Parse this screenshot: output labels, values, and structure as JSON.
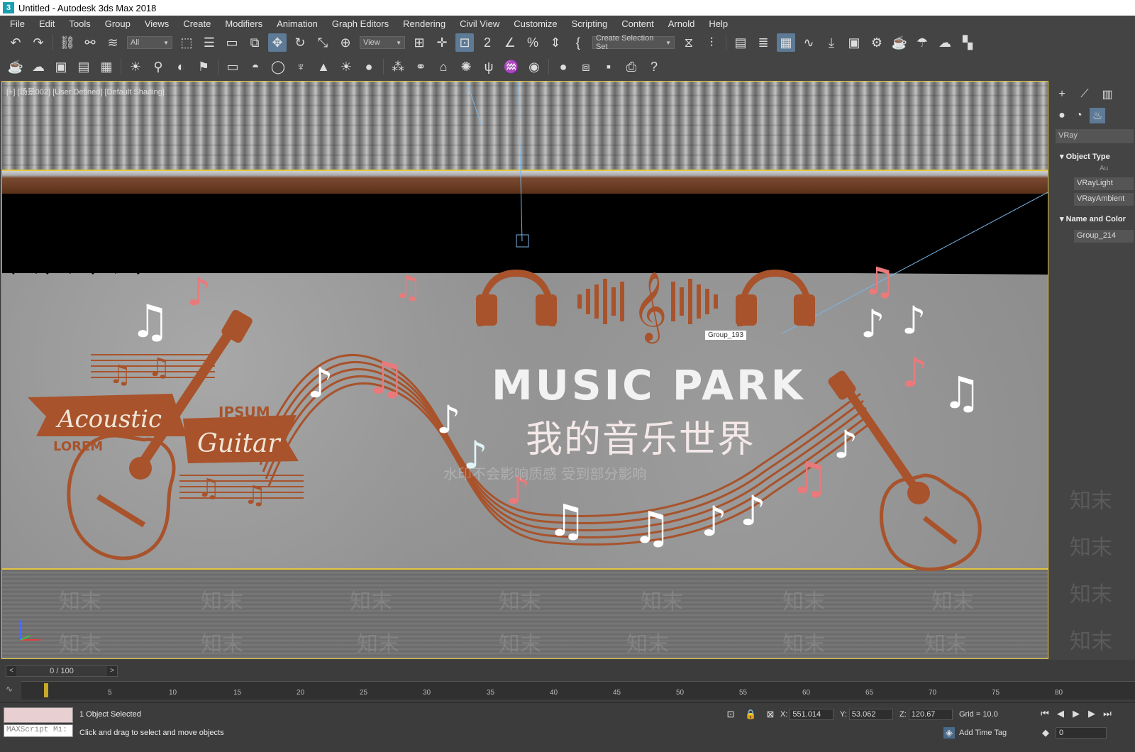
{
  "window": {
    "title": "Untitled - Autodesk 3ds Max 2018",
    "icon": "3"
  },
  "menu": [
    "File",
    "Edit",
    "Tools",
    "Group",
    "Views",
    "Create",
    "Modifiers",
    "Animation",
    "Graph Editors",
    "Rendering",
    "Civil View",
    "Customize",
    "Scripting",
    "Content",
    "Arnold",
    "Help"
  ],
  "toolbar1": {
    "filter": "All",
    "refcoord": "View",
    "selset": "Create Selection Set"
  },
  "viewport": {
    "label": "[+] [场景002] [User Defined] [Default Shading]",
    "title": "MUSIC PARK",
    "subtitle": "我的音乐世界",
    "banner1": "Acoustic",
    "banner2": "Guitar",
    "small1": "IPSUM",
    "small2": "LOREM",
    "selection_label": "Group_193",
    "watermark": "知末",
    "overlay_text": "水印不会影响质感 受到部分影响",
    "accent": "#e97a7c",
    "rust": "#a8532c"
  },
  "command_panel": {
    "renderer": "VRay",
    "rollout_object_type": "Object Type",
    "auto_grid": "Au",
    "btn1": "VRayLight",
    "btn2": "VRayAmbient",
    "rollout_name": "Name and Color",
    "object_name": "Group_214"
  },
  "timeline": {
    "position": "0 / 100",
    "ticks": [
      "5",
      "10",
      "15",
      "20",
      "25",
      "30",
      "35",
      "40",
      "45",
      "50",
      "55",
      "60",
      "65",
      "70",
      "75",
      "80"
    ]
  },
  "status": {
    "maxscript": "MAXScript Mi:",
    "selected": "1 Object Selected",
    "prompt": "Click and drag to select and move objects",
    "x": "551.014",
    "y": "53.062",
    "z": "120.67",
    "grid": "Grid = 10.0",
    "add_time_tag": "Add Time Tag",
    "frame": "0"
  }
}
